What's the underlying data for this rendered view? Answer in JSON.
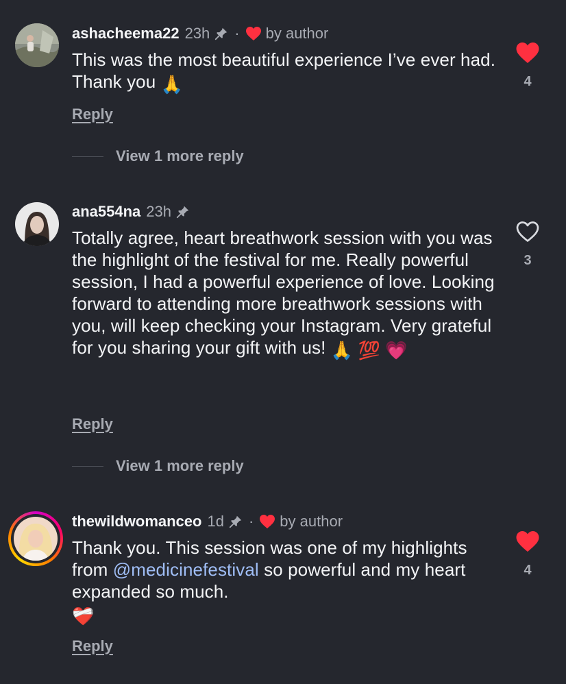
{
  "comments": [
    {
      "username": "ashacheema22",
      "time": "23h",
      "by_author": "by author",
      "text": "This was the most beautiful experience I’ve ever had. Thank you",
      "emoji": "🙏",
      "reply_label": "Reply",
      "more_replies": "View 1 more reply",
      "likes": "4",
      "liked": true
    },
    {
      "username": "ana554na",
      "time": "23h",
      "text": "Totally agree, heart breathwork session with you was the highlight of the festival for me. Really powerful session,  I had a powerful experience of love.  Looking forward to attending more breathwork sessions with you, will keep checking your Instagram.  Very grateful for you sharing your gift with us!",
      "emoji": "🙏 💯 💗",
      "reply_label": "Reply",
      "more_replies": "View 1 more reply",
      "likes": "3",
      "liked": false
    },
    {
      "username": "thewildwomanceo",
      "time": "1d",
      "by_author": "by author",
      "text_before": "Thank you. This session was one of my highlights from",
      "mention": "@medicinefestival",
      "text_after": "so powerful and my heart expanded so much.",
      "emoji": "❤️‍🩹",
      "reply_label": "Reply",
      "likes": "4",
      "liked": true
    }
  ],
  "colors": {
    "background": "#25272e",
    "like_red": "#ff3040",
    "mention": "#9fbdf5",
    "muted": "#a8abb3"
  },
  "icons": [
    "pin-icon",
    "heart-icon",
    "heart-outline-icon",
    "story-ring"
  ]
}
